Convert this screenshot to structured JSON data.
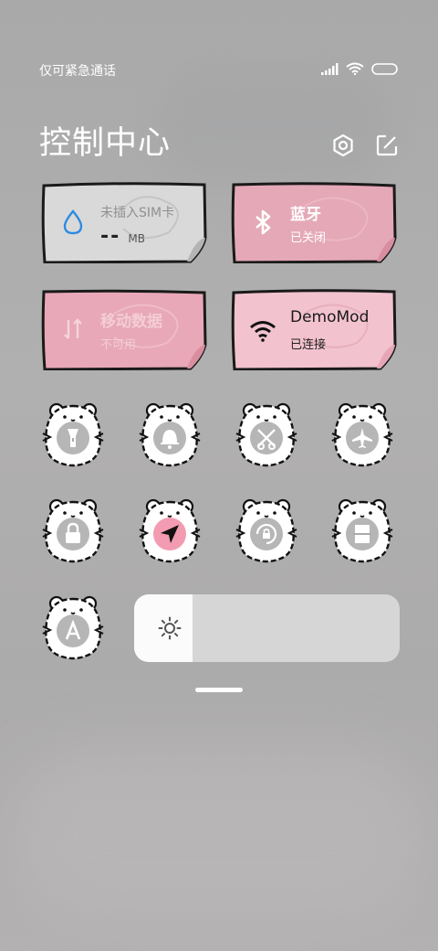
{
  "status_bar": {
    "carrier_text": "仅可紧急通话"
  },
  "header": {
    "title": "控制中心"
  },
  "cards": [
    {
      "id": "data-usage",
      "line1": "未插入SIM卡",
      "value": "--",
      "unit": "MB",
      "color": "#dad9d9",
      "icon": "drop-icon"
    },
    {
      "id": "bluetooth",
      "line1": "蓝牙",
      "line2": "已关闭",
      "color": "#e5a8b7",
      "icon": "bluetooth-icon"
    },
    {
      "id": "mobile-data",
      "line1": "移动数据",
      "line2": "不可用",
      "color": "#e8a8b7",
      "icon": "mobile-data-icon"
    },
    {
      "id": "wifi",
      "line1": "DemoMod",
      "line2": "已连接",
      "color": "#f2c2cf",
      "icon": "wifi-icon"
    }
  ],
  "toggles": [
    {
      "name": "flashlight",
      "icon": "flashlight-icon",
      "active": false
    },
    {
      "name": "silent",
      "icon": "bell-icon",
      "active": false
    },
    {
      "name": "screenshot",
      "icon": "scissors-icon",
      "active": false
    },
    {
      "name": "airplane",
      "icon": "airplane-icon",
      "active": false
    },
    {
      "name": "lock-screen",
      "icon": "lock-icon",
      "active": false
    },
    {
      "name": "location",
      "icon": "navigation-arrow-icon",
      "active": true
    },
    {
      "name": "rotation-lock",
      "icon": "rotation-lock-icon",
      "active": false
    },
    {
      "name": "screencast",
      "icon": "reading-mode-icon",
      "active": false
    },
    {
      "name": "auto-brightness",
      "icon": "auto-brightness-icon",
      "active": false
    }
  ],
  "brightness": {
    "level": 0.22,
    "icon": "sun-icon"
  },
  "colors": {
    "accent_pink": "#e8a8b7",
    "active_pink": "#f29bb1",
    "outline": "#1a1a1a"
  }
}
